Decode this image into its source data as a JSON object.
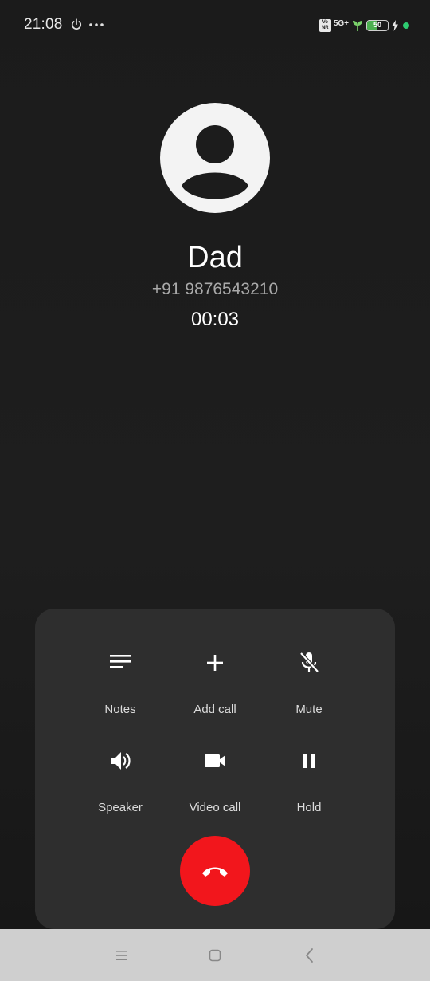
{
  "status_bar": {
    "time": "21:08",
    "volte_label": "Vo NR",
    "network": "5G+",
    "battery_level": "50",
    "battery_percent": 50,
    "charging": true,
    "colors": {
      "battery_fill": "#4caf50",
      "dot": "#2ecc71"
    },
    "icons": [
      "power-icon",
      "more-dots-icon",
      "leaf-icon",
      "charging-bolt-icon"
    ]
  },
  "caller": {
    "name": "Dad",
    "number": "+91 9876543210",
    "duration": "00:03"
  },
  "controls": [
    {
      "id": "notes",
      "label": "Notes",
      "icon": "notes-icon"
    },
    {
      "id": "add-call",
      "label": "Add call",
      "icon": "plus-icon"
    },
    {
      "id": "mute",
      "label": "Mute",
      "icon": "mic-off-icon"
    },
    {
      "id": "speaker",
      "label": "Speaker",
      "icon": "speaker-icon"
    },
    {
      "id": "video-call",
      "label": "Video call",
      "icon": "video-camera-icon"
    },
    {
      "id": "hold",
      "label": "Hold",
      "icon": "pause-icon"
    }
  ],
  "end_call": {
    "icon": "phone-hangup-icon",
    "color": "#f2161c"
  },
  "nav_bar": {
    "buttons": [
      "menu-icon",
      "home-icon",
      "back-icon"
    ]
  }
}
